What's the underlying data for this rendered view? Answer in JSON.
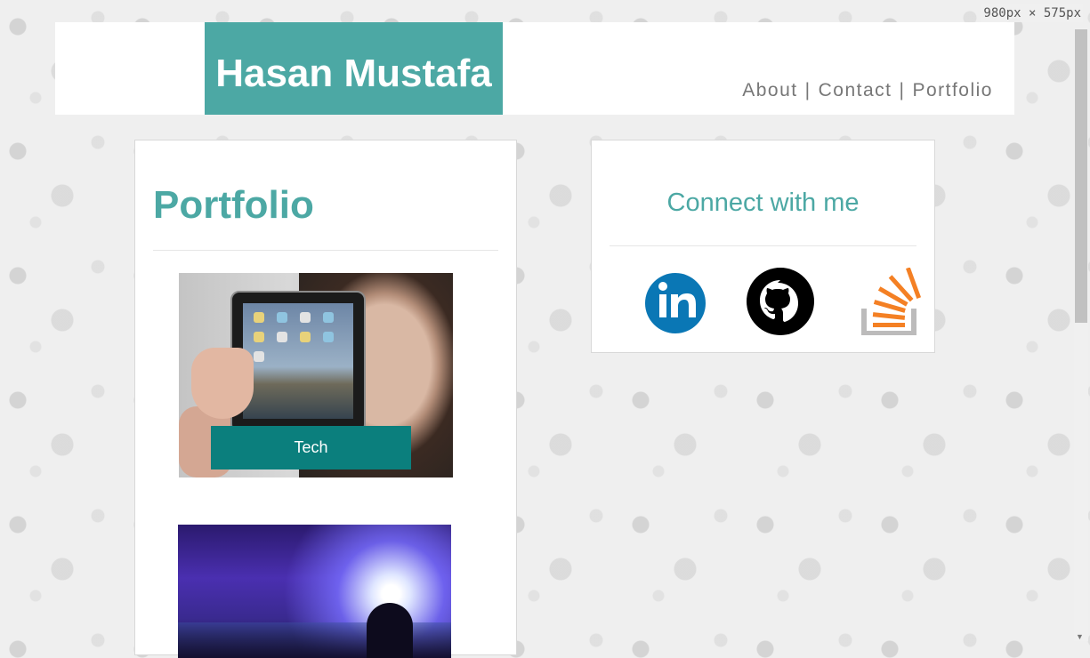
{
  "viewport_badge": "980px × 575px",
  "header": {
    "logo": "Hasan Mustafa",
    "nav": {
      "about": "About",
      "separator": "|",
      "contact": "Contact",
      "portfolio": "Portfolio"
    }
  },
  "main": {
    "title": "Portfolio",
    "tiles": [
      {
        "label": "Tech"
      },
      {
        "label": ""
      }
    ]
  },
  "sidebar": {
    "title": "Connect with me",
    "icons": [
      "linkedin-icon",
      "github-icon",
      "stackoverflow-icon"
    ]
  },
  "colors": {
    "accent": "#4ca8a4",
    "tile_label": "#0b7f7d",
    "linkedin": "#0a77b5",
    "stackoverflow": "#f48024"
  }
}
